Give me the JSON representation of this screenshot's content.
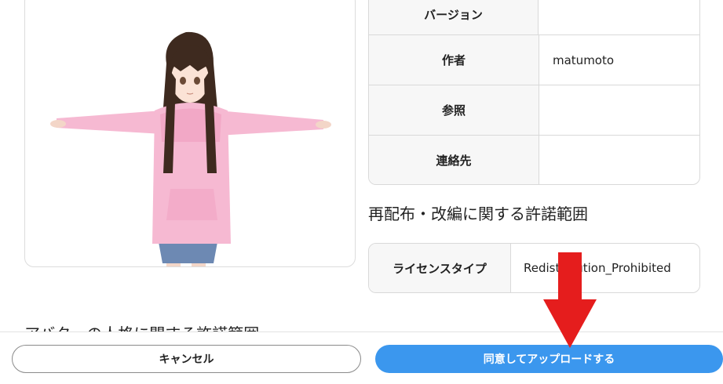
{
  "info_table": {
    "rows": [
      {
        "key": "バージョン",
        "value": ""
      },
      {
        "key": "作者",
        "value": "matumoto"
      },
      {
        "key": "参照",
        "value": ""
      },
      {
        "key": "連絡先",
        "value": ""
      }
    ]
  },
  "redistribution": {
    "title": "再配布・改編に関する許諾範囲",
    "license_key": "ライセンスタイプ",
    "license_value": "Redistribution_Prohibited"
  },
  "avatar_section": {
    "title": "アバターの人格に関する許諾範囲"
  },
  "footer": {
    "cancel_label": "キャンセル",
    "agree_label": "同意してアップロードする"
  },
  "colors": {
    "primary_button": "#3b97ee",
    "annotation_arrow": "#e51d1d",
    "hoodie": "#f6b9d2"
  }
}
